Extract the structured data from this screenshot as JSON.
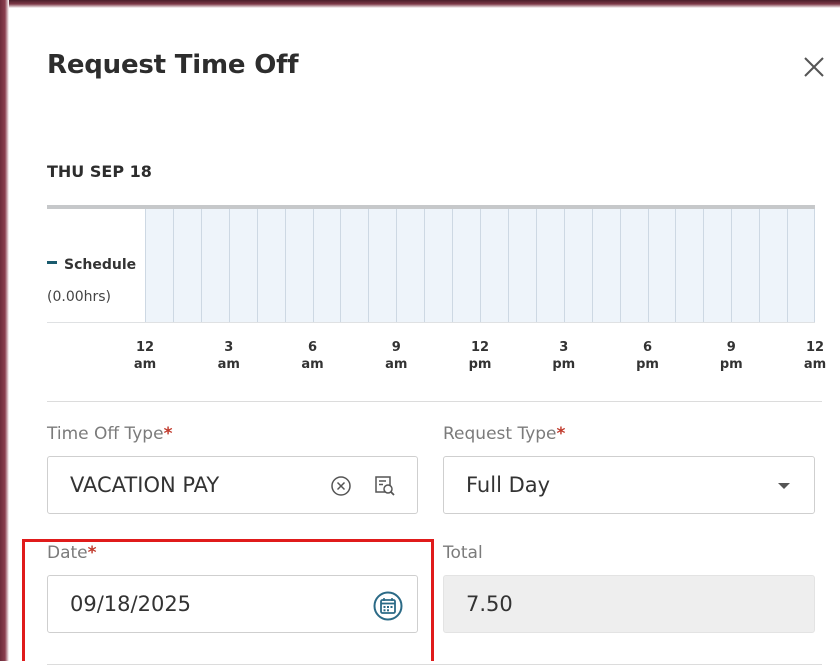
{
  "dialog": {
    "title": "Request Time Off",
    "close_icon": "close-icon"
  },
  "timeline": {
    "date_heading": "THU SEP 18",
    "schedule_label": "Schedule",
    "schedule_hours": "(0.00hrs)",
    "schedule_color": "#1a5b6e",
    "ticks": [
      {
        "top": "12",
        "bottom": "am"
      },
      {
        "top": "3",
        "bottom": "am"
      },
      {
        "top": "6",
        "bottom": "am"
      },
      {
        "top": "9",
        "bottom": "am"
      },
      {
        "top": "12",
        "bottom": "pm"
      },
      {
        "top": "3",
        "bottom": "pm"
      },
      {
        "top": "6",
        "bottom": "pm"
      },
      {
        "top": "9",
        "bottom": "pm"
      },
      {
        "top": "12",
        "bottom": "am"
      }
    ]
  },
  "form": {
    "time_off_type": {
      "label": "Time Off Type",
      "required_mark": "*",
      "value": "VACATION PAY",
      "clear_icon": "clear-circle-icon",
      "lookup_icon": "lookup-search-icon"
    },
    "request_type": {
      "label": "Request Type",
      "required_mark": "*",
      "value": "Full Day",
      "dropdown_icon": "caret-down-icon"
    },
    "date": {
      "label": "Date",
      "required_mark": "*",
      "value": "09/18/2025",
      "calendar_icon": "calendar-icon"
    },
    "total": {
      "label": "Total",
      "value": "7.50"
    }
  },
  "colors": {
    "required": "#c0392b",
    "highlight": "#e01b1b",
    "grid_fill": "#eef4fa",
    "accent": "#1a5b6e"
  }
}
